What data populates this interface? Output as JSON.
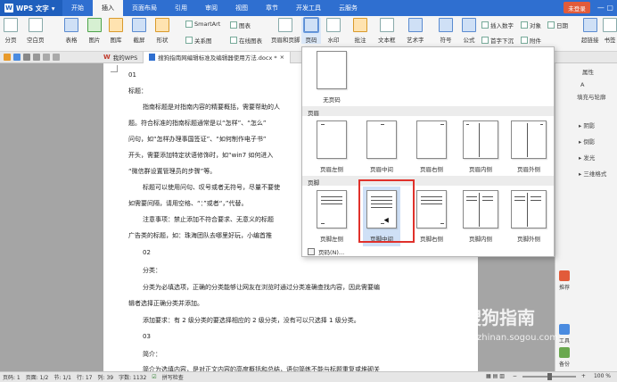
{
  "app": {
    "name": "WPS 文字",
    "login": "未登录"
  },
  "menu_tabs": [
    "开始",
    "插入",
    "页面布局",
    "引用",
    "审阅",
    "视图",
    "章节",
    "开发工具",
    "云服务"
  ],
  "ribbon": {
    "tools": [
      "分页",
      "空白页",
      "表格",
      "图片",
      "图库",
      "截屏",
      "形状",
      "关系图",
      "在线图表",
      "页眉和页脚",
      "页码",
      "水印",
      "批注",
      "文本框",
      "艺术字",
      "符号",
      "公式",
      "超链接",
      "书签"
    ],
    "small": {
      "smartart": "SmartArt",
      "chart": "图表",
      "insert_number": "插入数字",
      "object": "对象",
      "date": "日期",
      "first_letter": "首字下沉",
      "attachment": "附件"
    }
  },
  "tabs": [
    {
      "label": "我的WPS"
    },
    {
      "label": "搜狗指南网编辑标准及编辑器使用方法.docx *"
    }
  ],
  "document": {
    "lines": [
      "01",
      "标题：",
      "指南标题是对指南内容的精要概括，需要帮助的人",
      "题。符合标准的指南标题通常是以“怎样”、“怎么”",
      "问句，如“怎样办理事国签证”、“如何制作电子书”",
      "开头，需要添加特定状语修饰时，如“win7 如何进入",
      "“微信群设置管理员的步骤”等。",
      "标题可以使用问句、叹号或者无符号，尽量不要使",
      "如需要间隔，请用空格、“：”或者“，”代替。",
      "注意事项：禁止添加不符合要求、无意义的标题",
      "广告类的标题，如：珠海团队去哪里好玩，小编首推",
      "02",
      "分类：",
      "分类为必填选项，正确的分类能够让网友在浏览时通过分类准确查找内容，因此需要编",
      "辑者选择正确分类并添加。",
      "添加要求：有 2 级分类的要选择相应的 2 级分类，没有可以只选择 1 级分类。",
      "03",
      "简介：",
      "简介为选填内容，是对正文内容的高度概括和总结，语句简练不能与标题重复或堆砌关"
    ]
  },
  "dropdown": {
    "none_label": "无页码",
    "header_section": "页眉",
    "header_items": [
      "页眉左侧",
      "页眉中间",
      "页眉右侧",
      "页眉内侧",
      "页眉外侧"
    ],
    "footer_section": "页脚",
    "footer_items": [
      "页脚左侧",
      "页脚中间",
      "页脚右侧",
      "页脚内侧",
      "页脚外侧"
    ],
    "page_number_option": "页码(N)..."
  },
  "right_panel": {
    "header": "属性",
    "fill": "填充与轮廓",
    "items": [
      "阴影",
      "倒影",
      "发光",
      "三维格式"
    ],
    "side": [
      "推荐",
      "工具",
      "备份"
    ]
  },
  "status": {
    "page_no": "页码: 1",
    "page": "页面: 1/2",
    "section": "节: 1/1",
    "row": "行: 17",
    "col": "列: 39",
    "words": "字数: 1132",
    "spell": "拼写检查",
    "zoom": "100 %"
  },
  "watermark": {
    "brand": "搜狗指南",
    "url": "zhinan.sogou.com"
  }
}
